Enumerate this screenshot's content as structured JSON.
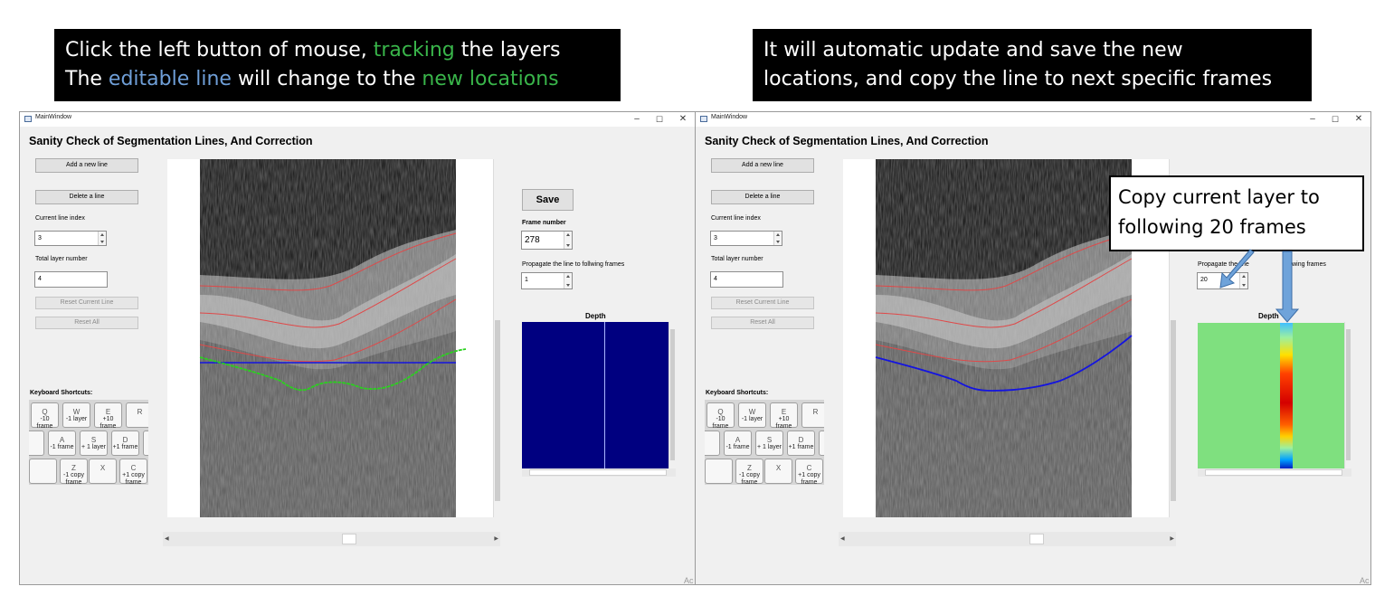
{
  "captions": {
    "left": {
      "line1_a": "Click the left button of mouse, ",
      "line1_b": "tracking",
      "line1_c": " the layers",
      "line2_a": "The ",
      "line2_b": "editable line",
      "line2_c": " will change to the ",
      "line2_d": "new locations"
    },
    "right": {
      "line1": "It will automatic update and save the new",
      "line2": "locations, and copy the line to next specific frames"
    }
  },
  "callout": {
    "line1": "Copy current layer to",
    "line2": "following 20 frames"
  },
  "window": {
    "title": "MainWindow",
    "minimize": "–",
    "maximize": "☐",
    "close": "✕",
    "app_title": "Sanity Check of Segmentation Lines, And Correction",
    "add_line": "Add a new line",
    "delete_line": "Delete a line",
    "current_line_label": "Current line index",
    "current_line_value": "3",
    "total_layer_label": "Total layer number",
    "total_layer_value": "4",
    "reset_current": "Reset Current Line",
    "reset_all": "Reset All",
    "shortcuts_label": "Keyboard Shortcuts:",
    "save": "Save",
    "frame_label": "Frame number",
    "frame_value": "278",
    "propagate_label": "Propagate the line to follwing frames",
    "propagate_visible": "Propagate the line",
    "propagate_tail": "llwing frames",
    "propagate_value_left": "1",
    "propagate_value_right": "20",
    "depth_label": "Depth",
    "depth_visible_right": "Depth",
    "corner_text": "Ac"
  },
  "keys": [
    {
      "key": "Q",
      "action": "-10 frame"
    },
    {
      "key": "W",
      "action": "-1 layer"
    },
    {
      "key": "E",
      "action": "+10 frame"
    },
    {
      "key": "R",
      "action": ""
    },
    {
      "key": "A",
      "action": "-1 frame"
    },
    {
      "key": "S",
      "action": "+ 1 layer"
    },
    {
      "key": "D",
      "action": "+1 frame"
    },
    {
      "key": "Z",
      "action": "-1 copy frame"
    },
    {
      "key": "X",
      "action": ""
    },
    {
      "key": "C",
      "action": "+1 copy frame"
    }
  ],
  "colors": {
    "caption_green": "#39b54a",
    "caption_blue": "#6f9fd8",
    "blue_line": "#1414e0",
    "green_line": "#2ad11e",
    "red_line": "#e04848",
    "depth_left_bg": "#000080",
    "depth_right_bg": "#7fe07f",
    "arrow_fill": "#6fa3da"
  }
}
